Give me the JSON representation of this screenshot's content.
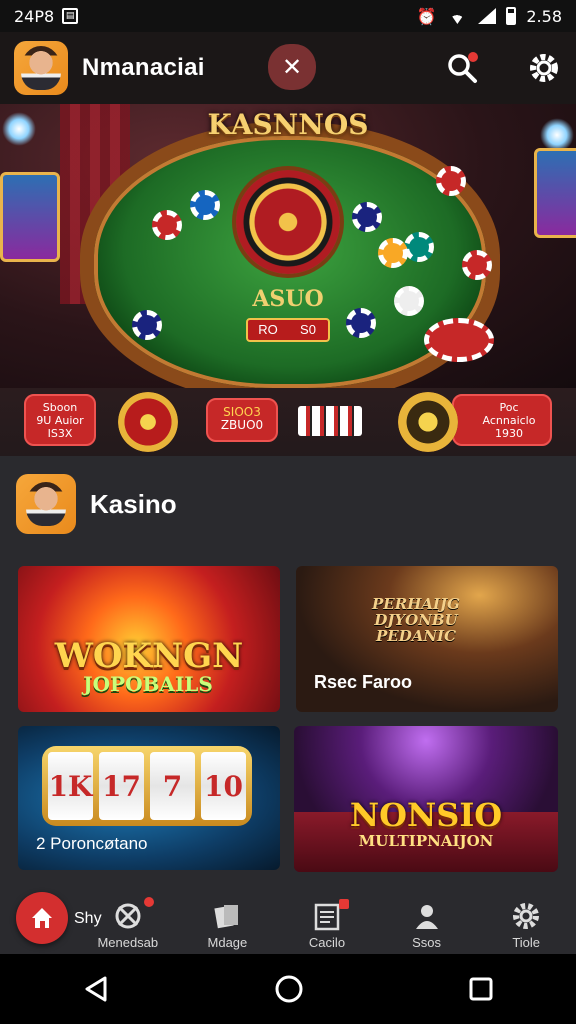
{
  "status_bar": {
    "left_text": "24P8",
    "time": "2.58"
  },
  "app_bar": {
    "title": "Nmanaciai"
  },
  "hero": {
    "sign": "KASNNOS",
    "table_text": "ASUO",
    "pill_left": "RO",
    "pill_right": "S0"
  },
  "promo": {
    "tag1": [
      "Sboon",
      "9U Auior",
      "IS3X"
    ],
    "tag2": [
      "SIOO3",
      "ZBUO0"
    ],
    "tag3": [
      "Poc",
      "Acnnaiclo",
      "1930"
    ]
  },
  "section": {
    "title": "Kasino",
    "tiles": [
      {
        "big": "WOKNGN",
        "sub": "JOPOBAILS"
      },
      {
        "headline": [
          "PERHAIJG",
          "DJYONBU",
          "PEDANIC"
        ],
        "caption": "Rsec Faroo"
      },
      {
        "reels": [
          "1K",
          "17",
          "7",
          "10"
        ],
        "caption": "2 Poroncøtano"
      },
      {
        "big": "NONSIO",
        "sub": "MULTIPNAIJON"
      }
    ]
  },
  "bottom_nav": {
    "home_label": "Shy",
    "items": [
      {
        "label": "Menedsab",
        "icon": "ball-icon"
      },
      {
        "label": "Mdage",
        "icon": "cards-icon"
      },
      {
        "label": "Cacilo",
        "icon": "document-icon"
      },
      {
        "label": "Ssos",
        "icon": "user-icon"
      },
      {
        "label": "Tiole",
        "icon": "gear-icon"
      }
    ]
  },
  "colors": {
    "accent": "#d32f2f",
    "bar_bg": "#1b1717",
    "panel": "#2a2a2e",
    "gold": "#f2c24a"
  }
}
